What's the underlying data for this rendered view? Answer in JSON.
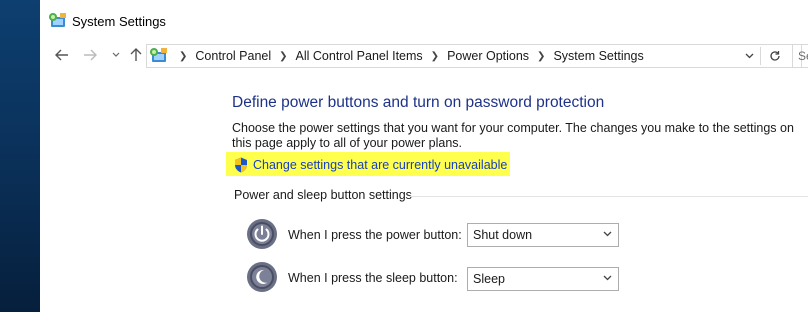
{
  "window": {
    "title": "System Settings",
    "title_icon": "control-panel-icon"
  },
  "nav": {
    "back_icon": "back-arrow-icon",
    "forward_icon": "forward-arrow-icon",
    "recent_icon": "chevron-down-icon",
    "up_icon": "up-arrow-icon"
  },
  "address": {
    "crumbs": [
      "Control Panel",
      "All Control Panel Items",
      "Power Options",
      "System Settings"
    ],
    "search_placeholder": "Se"
  },
  "content": {
    "heading": "Define power buttons and turn on password protection",
    "description": "Choose the power settings that you want for your computer. The changes you make to the settings on this page apply to all of your power plans.",
    "change_link": "Change settings that are currently unavailable",
    "group_label": "Power and sleep button settings",
    "power_button_label": "When I press the power button:",
    "power_button_value": "Shut down",
    "sleep_button_label": "When I press the sleep button:",
    "sleep_button_value": "Sleep"
  },
  "colors": {
    "heading": "#1e3287",
    "link": "#1a3fbd",
    "highlight": "#ffff4d"
  }
}
